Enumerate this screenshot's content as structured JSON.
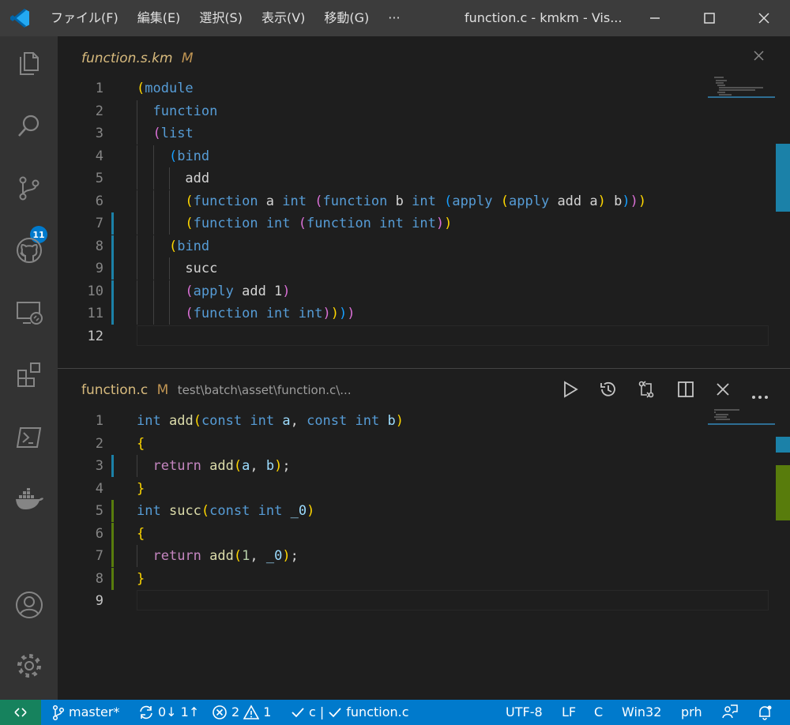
{
  "titlebar": {
    "menu": [
      "ファイル(F)",
      "編集(E)",
      "選択(S)",
      "表示(V)",
      "移動(G)",
      "···"
    ],
    "title": "function.c - kmkm - Vis..."
  },
  "activity": {
    "scm_badge": "11"
  },
  "top_editor": {
    "tab_name": "function.s.km",
    "tab_status": "M",
    "lines": [
      [
        "(module"
      ],
      [
        "  function"
      ],
      [
        "  (list"
      ],
      [
        "    (bind"
      ],
      [
        "      add"
      ],
      [
        "      (function a int (function b int (apply (apply add a) b)))"
      ],
      [
        "      (function int (function int int))"
      ],
      [
        "    (bind"
      ],
      [
        "      succ"
      ],
      [
        "      (apply add 1)"
      ],
      [
        "      (function int int))))"
      ],
      [
        ""
      ]
    ],
    "line_numbers": [
      "1",
      "2",
      "3",
      "4",
      "5",
      "6",
      "7",
      "8",
      "9",
      "10",
      "11",
      "12"
    ]
  },
  "bottom_editor": {
    "tab_name": "function.c",
    "tab_status": "M",
    "tab_path": "test\\batch\\asset\\function.c\\...",
    "line_numbers": [
      "1",
      "2",
      "3",
      "4",
      "5",
      "6",
      "7",
      "8",
      "9"
    ],
    "lines": [
      "int add(const int a, const int b)",
      "{",
      "  return add(a, b);",
      "}",
      "int succ(const int _0)",
      "{",
      "  return add(1, _0);",
      "}",
      ""
    ]
  },
  "statusbar": {
    "branch": "master*",
    "sync": "0↓ 1↑",
    "errors": "2",
    "warnings": "1",
    "check1": "c |",
    "check2": "function.c",
    "encoding": "UTF-8",
    "eol": "LF",
    "language": "C",
    "platform": "Win32",
    "prh": "prh"
  },
  "colors": {
    "accent": "#007acc",
    "modified_gutter": "#1b81a8",
    "added_gutter": "#587c0c",
    "tab_status": "#c09553"
  }
}
